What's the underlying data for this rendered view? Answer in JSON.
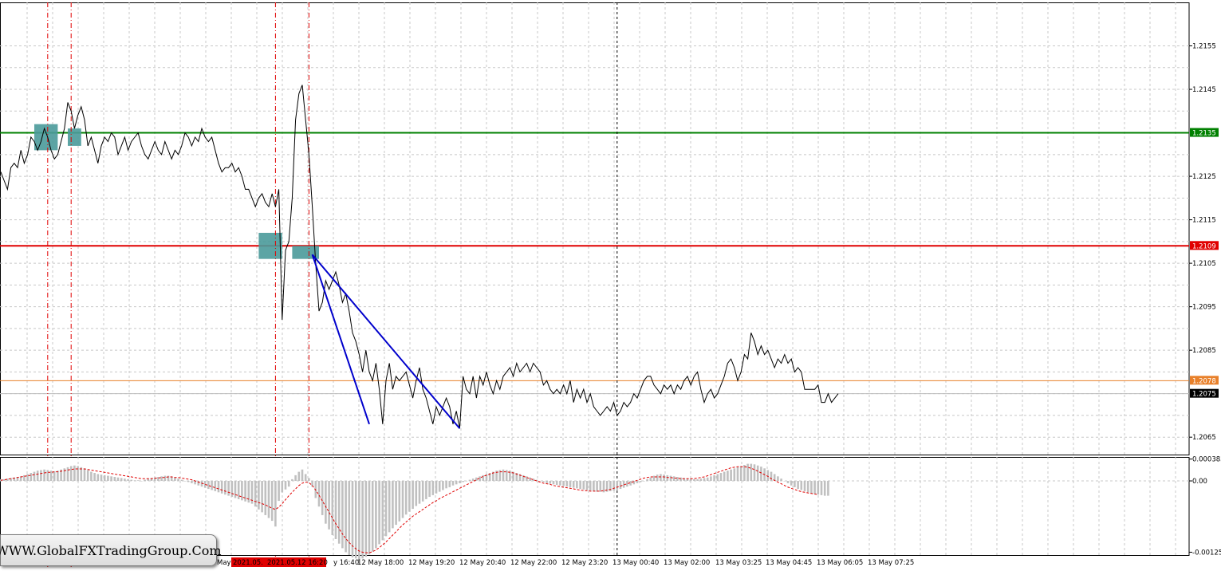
{
  "watermark": "WWW.GlobalFXTradingGroup.Com",
  "colors": {
    "price_line": "#000000",
    "support": "#008000",
    "resistance": "#e00000",
    "orange_level": "#e8802a",
    "trend": "#0000cc",
    "signal_box": "#4a9a9a",
    "histogram": "#c0c0c0",
    "signal_line": "#e00000",
    "grid": "#c8c8c8"
  },
  "chart_data": [
    {
      "type": "line",
      "title": "",
      "ylim": [
        1.2061,
        1.2165
      ],
      "y_ticks": [
        "1.2155",
        "1.2145",
        "1.2125",
        "1.2115",
        "1.2105",
        "1.2095",
        "1.2085",
        "1.2065"
      ],
      "price_tags": [
        {
          "label": "1.2135",
          "value": 1.2135,
          "color": "#008000"
        },
        {
          "label": "1.2109",
          "value": 1.2109,
          "color": "#e00000"
        },
        {
          "label": "1.2078",
          "value": 1.2078,
          "color": "#e8802a"
        },
        {
          "label": "1.2075",
          "value": 1.2075,
          "color": "#000000"
        }
      ],
      "horizontal_levels": [
        {
          "value": 1.2135,
          "color": "#008000"
        },
        {
          "value": 1.2109,
          "color": "#e00000"
        },
        {
          "value": 1.2078,
          "color": "#e8802a"
        },
        {
          "value": 1.2075,
          "color": "#bbbbbb"
        }
      ],
      "x_labels": [
        "y 16:40",
        "12 May 18:00",
        "12 May 19:20",
        "12 May 20:40",
        "12 May 22:00",
        "12 May 23:20",
        "13 May 00:40",
        "13 May 02:00",
        "13 May 03:25",
        "13 May 04:45",
        "13 May 06:05",
        "13 May 07:25"
      ],
      "x_markers": [
        "May",
        "2021.05.",
        "2021.05.12 16:20"
      ],
      "series": [
        {
          "values": [
            1.2126,
            1.2124,
            1.2122,
            1.2127,
            1.2128,
            1.2127,
            1.2131,
            1.2128,
            1.213,
            1.2134,
            1.2133,
            1.2131,
            1.2133,
            1.2136,
            1.2134,
            1.2131,
            1.2129,
            1.213,
            1.2133,
            1.2136,
            1.2142,
            1.214,
            1.2136,
            1.2139,
            1.2141,
            1.2138,
            1.2132,
            1.2134,
            1.2131,
            1.2128,
            1.2132,
            1.2134,
            1.2133,
            1.2135,
            1.2134,
            1.213,
            1.2132,
            1.2134,
            1.2131,
            1.2133,
            1.2134,
            1.2135,
            1.2132,
            1.213,
            1.2129,
            1.2131,
            1.2133,
            1.2131,
            1.213,
            1.2133,
            1.2131,
            1.2129,
            1.2131,
            1.213,
            1.2132,
            1.2135,
            1.2134,
            1.2132,
            1.2134,
            1.2133,
            1.2136,
            1.2134,
            1.2133,
            1.2134,
            1.2131,
            1.2128,
            1.2126,
            1.2127,
            1.2127,
            1.2128,
            1.2126,
            1.2127,
            1.2125,
            1.2122,
            1.2122,
            1.212,
            1.2118,
            1.212,
            1.2121,
            1.2119,
            1.2118,
            1.2121,
            1.2118,
            1.2122,
            1.2092,
            1.2108,
            1.211,
            1.212,
            1.2138,
            1.2144,
            1.2146,
            1.2138,
            1.213,
            1.2118,
            1.2105,
            1.2094,
            1.2096,
            1.2101,
            1.2099,
            1.2101,
            1.2103,
            1.21,
            1.2096,
            1.2098,
            1.2094,
            1.2089,
            1.2087,
            1.2084,
            1.208,
            1.2085,
            1.208,
            1.2078,
            1.2082,
            1.2076,
            1.2068,
            1.2078,
            1.2082,
            1.2076,
            1.2079,
            1.2078,
            1.2079,
            1.208,
            1.2077,
            1.2074,
            1.2078,
            1.2081,
            1.2076,
            1.2074,
            1.2071,
            1.2068,
            1.2072,
            1.207,
            1.2072,
            1.2074,
            1.2072,
            1.2068,
            1.2071,
            1.2067,
            1.2079,
            1.2076,
            1.2075,
            1.2079,
            1.2074,
            1.2079,
            1.2077,
            1.208,
            1.2077,
            1.2075,
            1.2078,
            1.2076,
            1.2079,
            1.208,
            1.2081,
            1.2079,
            1.2082,
            1.208,
            1.2081,
            1.2082,
            1.208,
            1.2082,
            1.2081,
            1.208,
            1.2077,
            1.2078,
            1.2076,
            1.2075,
            1.2076,
            1.2075,
            1.2077,
            1.2075,
            1.2078,
            1.2073,
            1.2076,
            1.2074,
            1.2076,
            1.2073,
            1.2075,
            1.2072,
            1.2071,
            1.207,
            1.2071,
            1.2072,
            1.2071,
            1.2073,
            1.207,
            1.2071,
            1.2073,
            1.2072,
            1.2073,
            1.2075,
            1.2074,
            1.2076,
            1.2078,
            1.2079,
            1.2079,
            1.2077,
            1.2076,
            1.2075,
            1.2077,
            1.2076,
            1.2077,
            1.2075,
            1.2077,
            1.2076,
            1.2078,
            1.2079,
            1.2077,
            1.2079,
            1.208,
            1.2076,
            1.2073,
            1.2075,
            1.2076,
            1.2074,
            1.2075,
            1.2077,
            1.2079,
            1.2082,
            1.2083,
            1.2081,
            1.2078,
            1.208,
            1.2084,
            1.2083,
            1.2089,
            1.2087,
            1.2084,
            1.2086,
            1.2084,
            1.2085,
            1.2083,
            1.2081,
            1.2083,
            1.2082,
            1.2084,
            1.2082,
            1.2083,
            1.208,
            1.2081,
            1.208,
            1.2076,
            1.2076,
            1.2076,
            1.2076,
            1.2077,
            1.2073,
            1.2073,
            1.2075,
            1.2073,
            1.2074,
            1.2075
          ]
        }
      ],
      "trend_lines": [
        {
          "from_index": 93,
          "from_value": 1.2107,
          "to_index": 110,
          "to_value": 1.2068
        },
        {
          "from_index": 93,
          "from_value": 1.2107,
          "to_index": 137,
          "to_value": 1.2067
        }
      ],
      "signal_boxes": [
        {
          "start_index": 10,
          "end_index": 17,
          "low": 1.2131,
          "high": 1.2137
        },
        {
          "start_index": 20,
          "end_index": 24,
          "low": 1.2132,
          "high": 1.2136
        },
        {
          "start_index": 77,
          "end_index": 84,
          "low": 1.2106,
          "high": 1.2112
        },
        {
          "start_index": 87,
          "end_index": 95,
          "low": 1.2106,
          "high": 1.2109
        }
      ],
      "vertical_markers": [
        14,
        21,
        82,
        92
      ],
      "crosshair_index": 184
    },
    {
      "type": "bar",
      "title": "",
      "ylim": [
        -0.0013,
        0.00042
      ],
      "y_ticks": [
        "0.000383",
        "0.00",
        "-0.00125"
      ],
      "histogram": [
        3e-05,
        3e-05,
        4e-05,
        5e-05,
        6e-05,
        7e-05,
        8e-05,
        0.0001,
        0.00012,
        0.00014,
        0.00016,
        0.00018,
        0.00019,
        0.0002,
        0.00019,
        0.00018,
        0.00017,
        0.00018,
        0.0002,
        0.00022,
        0.00024,
        0.00026,
        0.00027,
        0.00026,
        0.00024,
        0.00022,
        0.00019,
        0.00016,
        0.00014,
        0.00012,
        0.00011,
        0.0001,
        9e-05,
        8e-05,
        7e-05,
        6e-05,
        5e-05,
        4e-05,
        3e-05,
        2e-05,
        1e-05,
        1e-05,
        0.0,
        2e-05,
        4e-05,
        5e-05,
        6e-05,
        7e-05,
        8e-05,
        9e-05,
        9e-05,
        8e-05,
        6e-05,
        4e-05,
        2e-05,
        0.0,
        -2e-05,
        -4e-05,
        -6e-05,
        -8e-05,
        -0.0001,
        -0.00012,
        -0.00014,
        -0.00016,
        -0.00018,
        -0.0002,
        -0.00022,
        -0.00024,
        -0.00026,
        -0.00028,
        -0.0003,
        -0.00032,
        -0.00034,
        -0.00036,
        -0.00038,
        -0.0004,
        -0.00045,
        -0.0005,
        -0.00055,
        -0.0006,
        -0.00065,
        -0.0007,
        -0.0008,
        -0.00035,
        -0.0002,
        -0.00015,
        -0.0001,
        3e-05,
        0.0001,
        0.00016,
        0.0002,
        0.00012,
        5e-05,
        -0.0001,
        -0.0003,
        -0.00045,
        -0.0006,
        -0.00075,
        -0.00085,
        -0.00095,
        -0.00102,
        -0.0011,
        -0.00118,
        -0.00125,
        -0.0013,
        -0.00134,
        -0.00136,
        -0.00138,
        -0.00136,
        -0.00133,
        -0.00129,
        -0.00124,
        -0.00118,
        -0.00111,
        -0.00104,
        -0.00097,
        -0.0009,
        -0.00083,
        -0.00077,
        -0.00071,
        -0.00065,
        -0.00059,
        -0.00054,
        -0.00049,
        -0.00044,
        -0.0004,
        -0.00036,
        -0.00032,
        -0.00028,
        -0.00025,
        -0.00022,
        -0.00019,
        -0.00016,
        -0.00013,
        -0.00011,
        -8e-05,
        -6e-05,
        -4e-05,
        -2e-05,
        0.0,
        2e-05,
        4e-05,
        6e-05,
        8e-05,
        0.0001,
        0.00012,
        0.00014,
        0.00016,
        0.00018,
        0.00019,
        0.0002,
        0.00019,
        0.00018,
        0.00016,
        0.00014,
        0.00012,
        0.0001,
        8e-05,
        6e-05,
        4e-05,
        2e-05,
        0.0,
        -2e-05,
        -4e-05,
        -5e-05,
        -6e-05,
        -7e-05,
        -8e-05,
        -9e-05,
        -0.0001,
        -0.00011,
        -0.00012,
        -0.00013,
        -0.00014,
        -0.00015,
        -0.00016,
        -0.00017,
        -0.00018,
        -0.00019,
        -0.00019,
        -0.0002,
        -0.00019,
        -0.00018,
        -0.00017,
        -0.00016,
        -0.00014,
        -0.00012,
        -0.0001,
        -8e-05,
        -6e-05,
        -4e-05,
        -2e-05,
        0.0,
        3e-05,
        6e-05,
        9e-05,
        0.00011,
        0.00012,
        0.00011,
        0.0001,
        9e-05,
        8e-05,
        7e-05,
        6e-05,
        5e-05,
        4e-05,
        4e-05,
        3e-05,
        3e-05,
        4e-05,
        5e-05,
        6e-05,
        8e-05,
        0.0001,
        0.00012,
        0.00014,
        0.00016,
        0.00018,
        0.0002,
        0.00022,
        0.00024,
        0.00026,
        0.00028,
        0.0003,
        0.0003,
        0.00029,
        0.00027,
        0.00025,
        0.00022,
        0.00019,
        0.00016,
        0.00012,
        8e-05,
        4e-05,
        0.0,
        -4e-05,
        -8e-05,
        -0.00011,
        -0.00014,
        -0.00016,
        -0.00018,
        -0.0002,
        -0.00022,
        -0.00023,
        -0.00024,
        -0.00025,
        -0.00026,
        -0.00026
      ],
      "signal": [
        1e-05,
        2e-05,
        3e-05,
        4e-05,
        5e-05,
        6e-05,
        7e-05,
        8e-05,
        9e-05,
        0.0001,
        0.00011,
        0.00012,
        0.00013,
        0.00014,
        0.00015,
        0.00015,
        0.00016,
        0.00016,
        0.00017,
        0.00018,
        0.00019,
        0.0002,
        0.00021,
        0.00021,
        0.00021,
        0.00021,
        0.0002,
        0.00019,
        0.00018,
        0.00017,
        0.00016,
        0.00015,
        0.00014,
        0.00013,
        0.00012,
        0.00011,
        0.0001,
        9e-05,
        8e-05,
        7e-05,
        6e-05,
        5e-05,
        4e-05,
        4e-05,
        4e-05,
        4e-05,
        5e-05,
        5e-05,
        6e-05,
        6e-05,
        7e-05,
        7e-05,
        6e-05,
        6e-05,
        5e-05,
        4e-05,
        3e-05,
        2e-05,
        0.0,
        -2e-05,
        -4e-05,
        -6e-05,
        -8e-05,
        -0.0001,
        -0.00012,
        -0.00014,
        -0.00016,
        -0.00018,
        -0.0002,
        -0.00022,
        -0.00024,
        -0.00026,
        -0.00028,
        -0.0003,
        -0.00032,
        -0.00034,
        -0.00036,
        -0.00038,
        -0.0004,
        -0.00042,
        -0.00045,
        -0.00048,
        -0.0005,
        -0.00046,
        -0.0004,
        -0.00033,
        -0.00026,
        -0.0002,
        -0.00014,
        -8e-05,
        -4e-05,
        -2e-05,
        -3e-05,
        -8e-05,
        -0.00016,
        -0.00025,
        -0.00035,
        -0.00045,
        -0.00055,
        -0.00065,
        -0.00075,
        -0.00084,
        -0.00093,
        -0.00101,
        -0.00108,
        -0.00114,
        -0.00119,
        -0.00123,
        -0.00125,
        -0.00126,
        -0.00126,
        -0.00124,
        -0.00121,
        -0.00117,
        -0.00112,
        -0.00107,
        -0.00101,
        -0.00095,
        -0.00089,
        -0.00083,
        -0.00077,
        -0.00072,
        -0.00067,
        -0.00062,
        -0.00058,
        -0.00054,
        -0.0005,
        -0.00046,
        -0.00042,
        -0.00038,
        -0.00035,
        -0.00031,
        -0.00028,
        -0.00025,
        -0.00022,
        -0.00019,
        -0.00016,
        -0.00013,
        -0.0001,
        -7e-05,
        -4e-05,
        -1e-05,
        2e-05,
        5e-05,
        8e-05,
        0.0001,
        0.00012,
        0.00014,
        0.00015,
        0.00016,
        0.00016,
        0.00016,
        0.00015,
        0.00014,
        0.00012,
        0.0001,
        8e-05,
        6e-05,
        4e-05,
        2e-05,
        0.0,
        -2e-05,
        -4e-05,
        -5e-05,
        -6e-05,
        -8e-05,
        -9e-05,
        -0.0001,
        -0.00011,
        -0.00012,
        -0.00013,
        -0.00014,
        -0.00015,
        -0.00016,
        -0.00017,
        -0.00017,
        -0.00018,
        -0.00018,
        -0.00018,
        -0.00018,
        -0.00017,
        -0.00016,
        -0.00015,
        -0.00013,
        -0.00011,
        -9e-05,
        -7e-05,
        -5e-05,
        -3e-05,
        -1e-05,
        1e-05,
        3e-05,
        5e-05,
        6e-05,
        7e-05,
        7e-05,
        7e-05,
        7e-05,
        7e-05,
        6e-05,
        6e-05,
        5e-05,
        5e-05,
        4e-05,
        4e-05,
        4e-05,
        4e-05,
        4e-05,
        5e-05,
        6e-05,
        7e-05,
        9e-05,
        0.00011,
        0.00013,
        0.00015,
        0.00017,
        0.00019,
        0.00021,
        0.00023,
        0.00024,
        0.00025,
        0.00025,
        0.00025,
        0.00024,
        0.00022,
        0.0002,
        0.00017,
        0.00014,
        0.00011,
        8e-05,
        4e-05,
        1e-05,
        -2e-05,
        -5e-05,
        -8e-05,
        -0.00011,
        -0.00013,
        -0.00015,
        -0.00017,
        -0.00019,
        -0.0002,
        -0.00021,
        -0.00022,
        -0.00023,
        -0.00024
      ]
    }
  ]
}
